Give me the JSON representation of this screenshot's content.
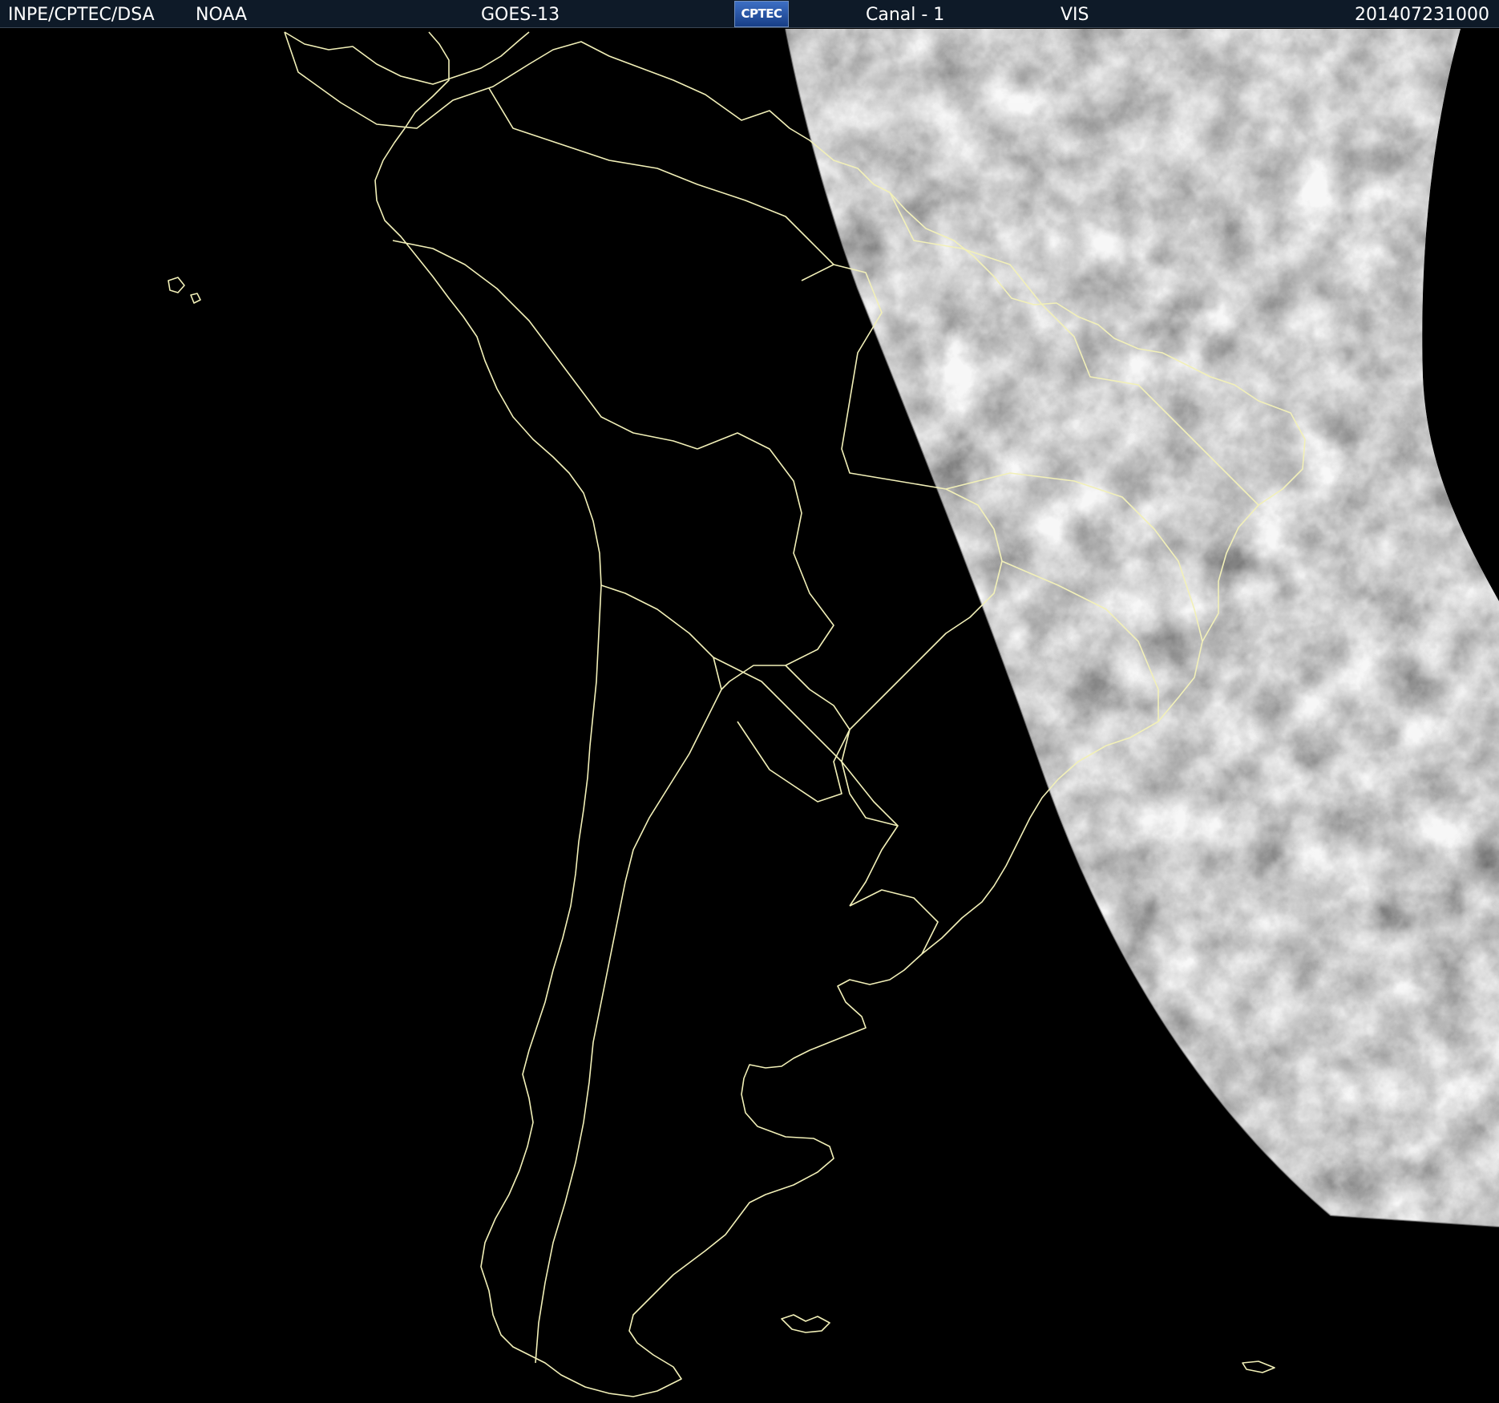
{
  "header": {
    "institution": "INPE/CPTEC/DSA",
    "agency": "NOAA",
    "satellite": "GOES-13",
    "logo_text": "CPTEC",
    "channel": "Canal - 1",
    "band": "VIS",
    "timestamp": "201407231000"
  },
  "colors": {
    "header_background": "#0e1a28",
    "header_text": "#ffffff",
    "coastline": "#f2f0b8",
    "background": "#000000",
    "cloud_gray": "#7a7a7a"
  },
  "map": {
    "projection": "satellite image",
    "region": "South America",
    "daylight_side": "east"
  }
}
